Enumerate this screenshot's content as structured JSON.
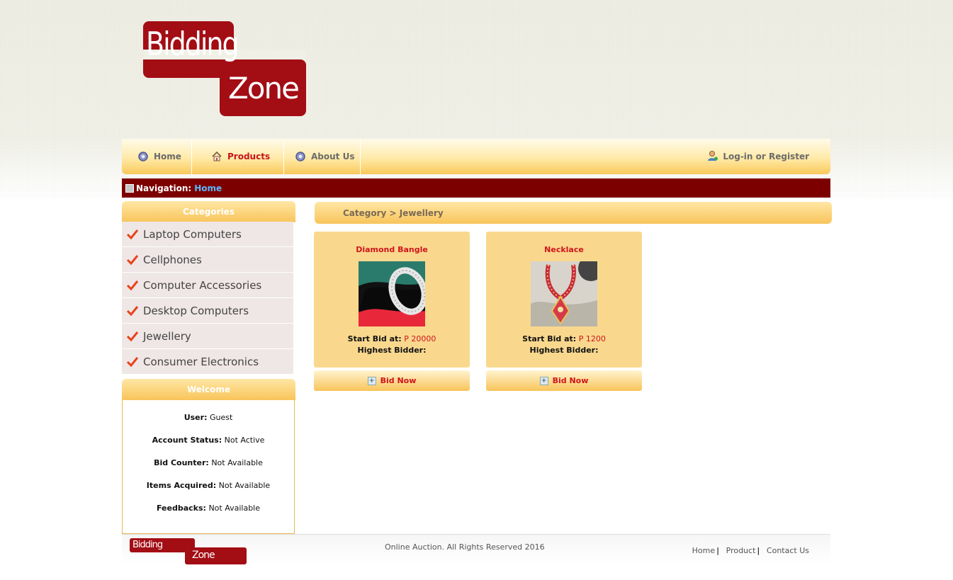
{
  "logo": {
    "line1": "Bidding",
    "line2": "Zone"
  },
  "topnav": {
    "items": [
      {
        "label": "Home",
        "icon": "gear-icon"
      },
      {
        "label": "Products",
        "icon": "home-icon"
      },
      {
        "label": "About Us",
        "icon": "gear-icon"
      }
    ],
    "login_label": "Log-in or Register"
  },
  "navbar": {
    "prefix": "Navigation:",
    "current": "Home"
  },
  "sidebar": {
    "categories_title": "Categories",
    "categories": [
      "Laptop Computers",
      "Cellphones",
      "Computer Accessories",
      "Desktop Computers",
      "Jewellery",
      "Consumer Electronics"
    ],
    "welcome_title": "Welcome",
    "welcome": [
      {
        "label": "User:",
        "value": "Guest"
      },
      {
        "label": "Account Status:",
        "value": "Not Active"
      },
      {
        "label": "Bid Counter:",
        "value": "Not Available"
      },
      {
        "label": "Items Acquired:",
        "value": "Not Available"
      },
      {
        "label": "Feedbacks:",
        "value": "Not Available"
      }
    ]
  },
  "content": {
    "breadcrumb": "Category > Jewellery",
    "products": [
      {
        "name": "Diamond Bangle",
        "bid_label": "Start Bid at:",
        "bid_value": "P 20000",
        "bidder_label": "Highest Bidder:",
        "button": "Bid Now"
      },
      {
        "name": "Necklace",
        "bid_label": "Start Bid at:",
        "bid_value": "P 1200",
        "bidder_label": "Highest Bidder:",
        "button": "Bid Now"
      }
    ]
  },
  "footer": {
    "logo_line1": "Bidding",
    "logo_line2": "Zone",
    "copyright": "Online Auction. All Rights Reserved 2016",
    "links": [
      "Home",
      "Product",
      "Contact Us"
    ]
  },
  "colors": {
    "accent": "#7d0000",
    "brand": "#a30d14",
    "highlight": "#d0141b",
    "gold": "#f8c45a"
  }
}
